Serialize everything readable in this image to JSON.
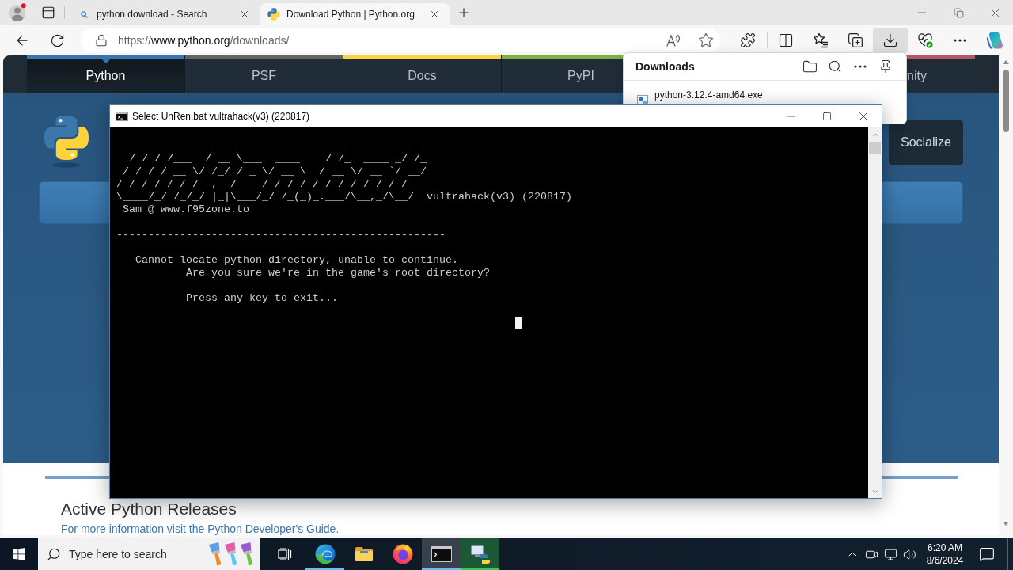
{
  "browser": {
    "tabs": [
      {
        "title": "python download - Search",
        "kind": "search",
        "selected": false
      },
      {
        "title": "Download Python | Python.org",
        "kind": "python",
        "selected": true
      }
    ],
    "address_bar": {
      "scheme": "https://",
      "host": "www.python.org",
      "path": "/downloads/"
    },
    "toolbar_buttons": [
      {
        "kind": "extensions",
        "active": false
      },
      {
        "kind": "split",
        "active": false
      },
      {
        "kind": "favorites",
        "active": false
      },
      {
        "kind": "collections",
        "active": false
      },
      {
        "kind": "downloads",
        "active": true
      },
      {
        "kind": "essentials",
        "active": false
      },
      {
        "kind": "more",
        "active": false
      },
      {
        "kind": "copilot",
        "active": false
      }
    ]
  },
  "downloads_panel": {
    "title": "Downloads",
    "items": [
      {
        "file_name": "python-3.12.4-amd64.exe"
      }
    ]
  },
  "page": {
    "nav": [
      {
        "label": "Python",
        "selected": true,
        "color": "#3776ab"
      },
      {
        "label": "PSF",
        "selected": false,
        "color": "#646565"
      },
      {
        "label": "Docs",
        "selected": false,
        "color": "#ffd343"
      },
      {
        "label": "PyPI",
        "selected": false,
        "color": "#82b043"
      },
      {
        "label": "nity",
        "selected": false,
        "color": "#b55863"
      }
    ],
    "socialize_button": "Socialize",
    "releases_heading": "Active Python Releases",
    "releases_note": "For more information visit the Python Developer's Guide."
  },
  "console": {
    "title": "Select UnRen.bat vultrahack(v3) (220817)",
    "banner_art": "   __  __      ____               __          __\n  / / / /___  / __ \\___  ____    / /_  ____ _/ /_\n / / / / __ \\/ /_/ / _ \\/ __ \\  / __ \\/ __ `/ __/\n/ /_/ / / / / _, _/  __/ / / / / /_/ / /_/ / /_\n\\____/_/ /_/_/ |_|\\___/_/ /_(_)_.___/\\__,_/\\__/",
    "banner_version": "vultrahack(v3) (220817)",
    "blocks": [
      [
        " Sam @ www.f95zone.to"
      ],
      [
        "----------------------------------------------------"
      ],
      [
        "   Cannot locate python directory, unable to continue.",
        "           Are you sure we're in the game's root directory?"
      ],
      [
        "           Press any key to exit..."
      ]
    ]
  },
  "taskbar": {
    "search": {
      "placeholder": "Type here to search"
    },
    "apps": [
      {
        "kind": "edge",
        "running": true,
        "selected": false
      },
      {
        "kind": "explorer",
        "running": false,
        "selected": false
      },
      {
        "kind": "firefox",
        "running": false,
        "selected": false
      },
      {
        "kind": "console",
        "running": true,
        "selected": true
      },
      {
        "kind": "installer",
        "running": true,
        "selected": false,
        "level": 1
      }
    ],
    "clock": {
      "time": "6:20 AM",
      "date": "8/6/2024"
    }
  }
}
